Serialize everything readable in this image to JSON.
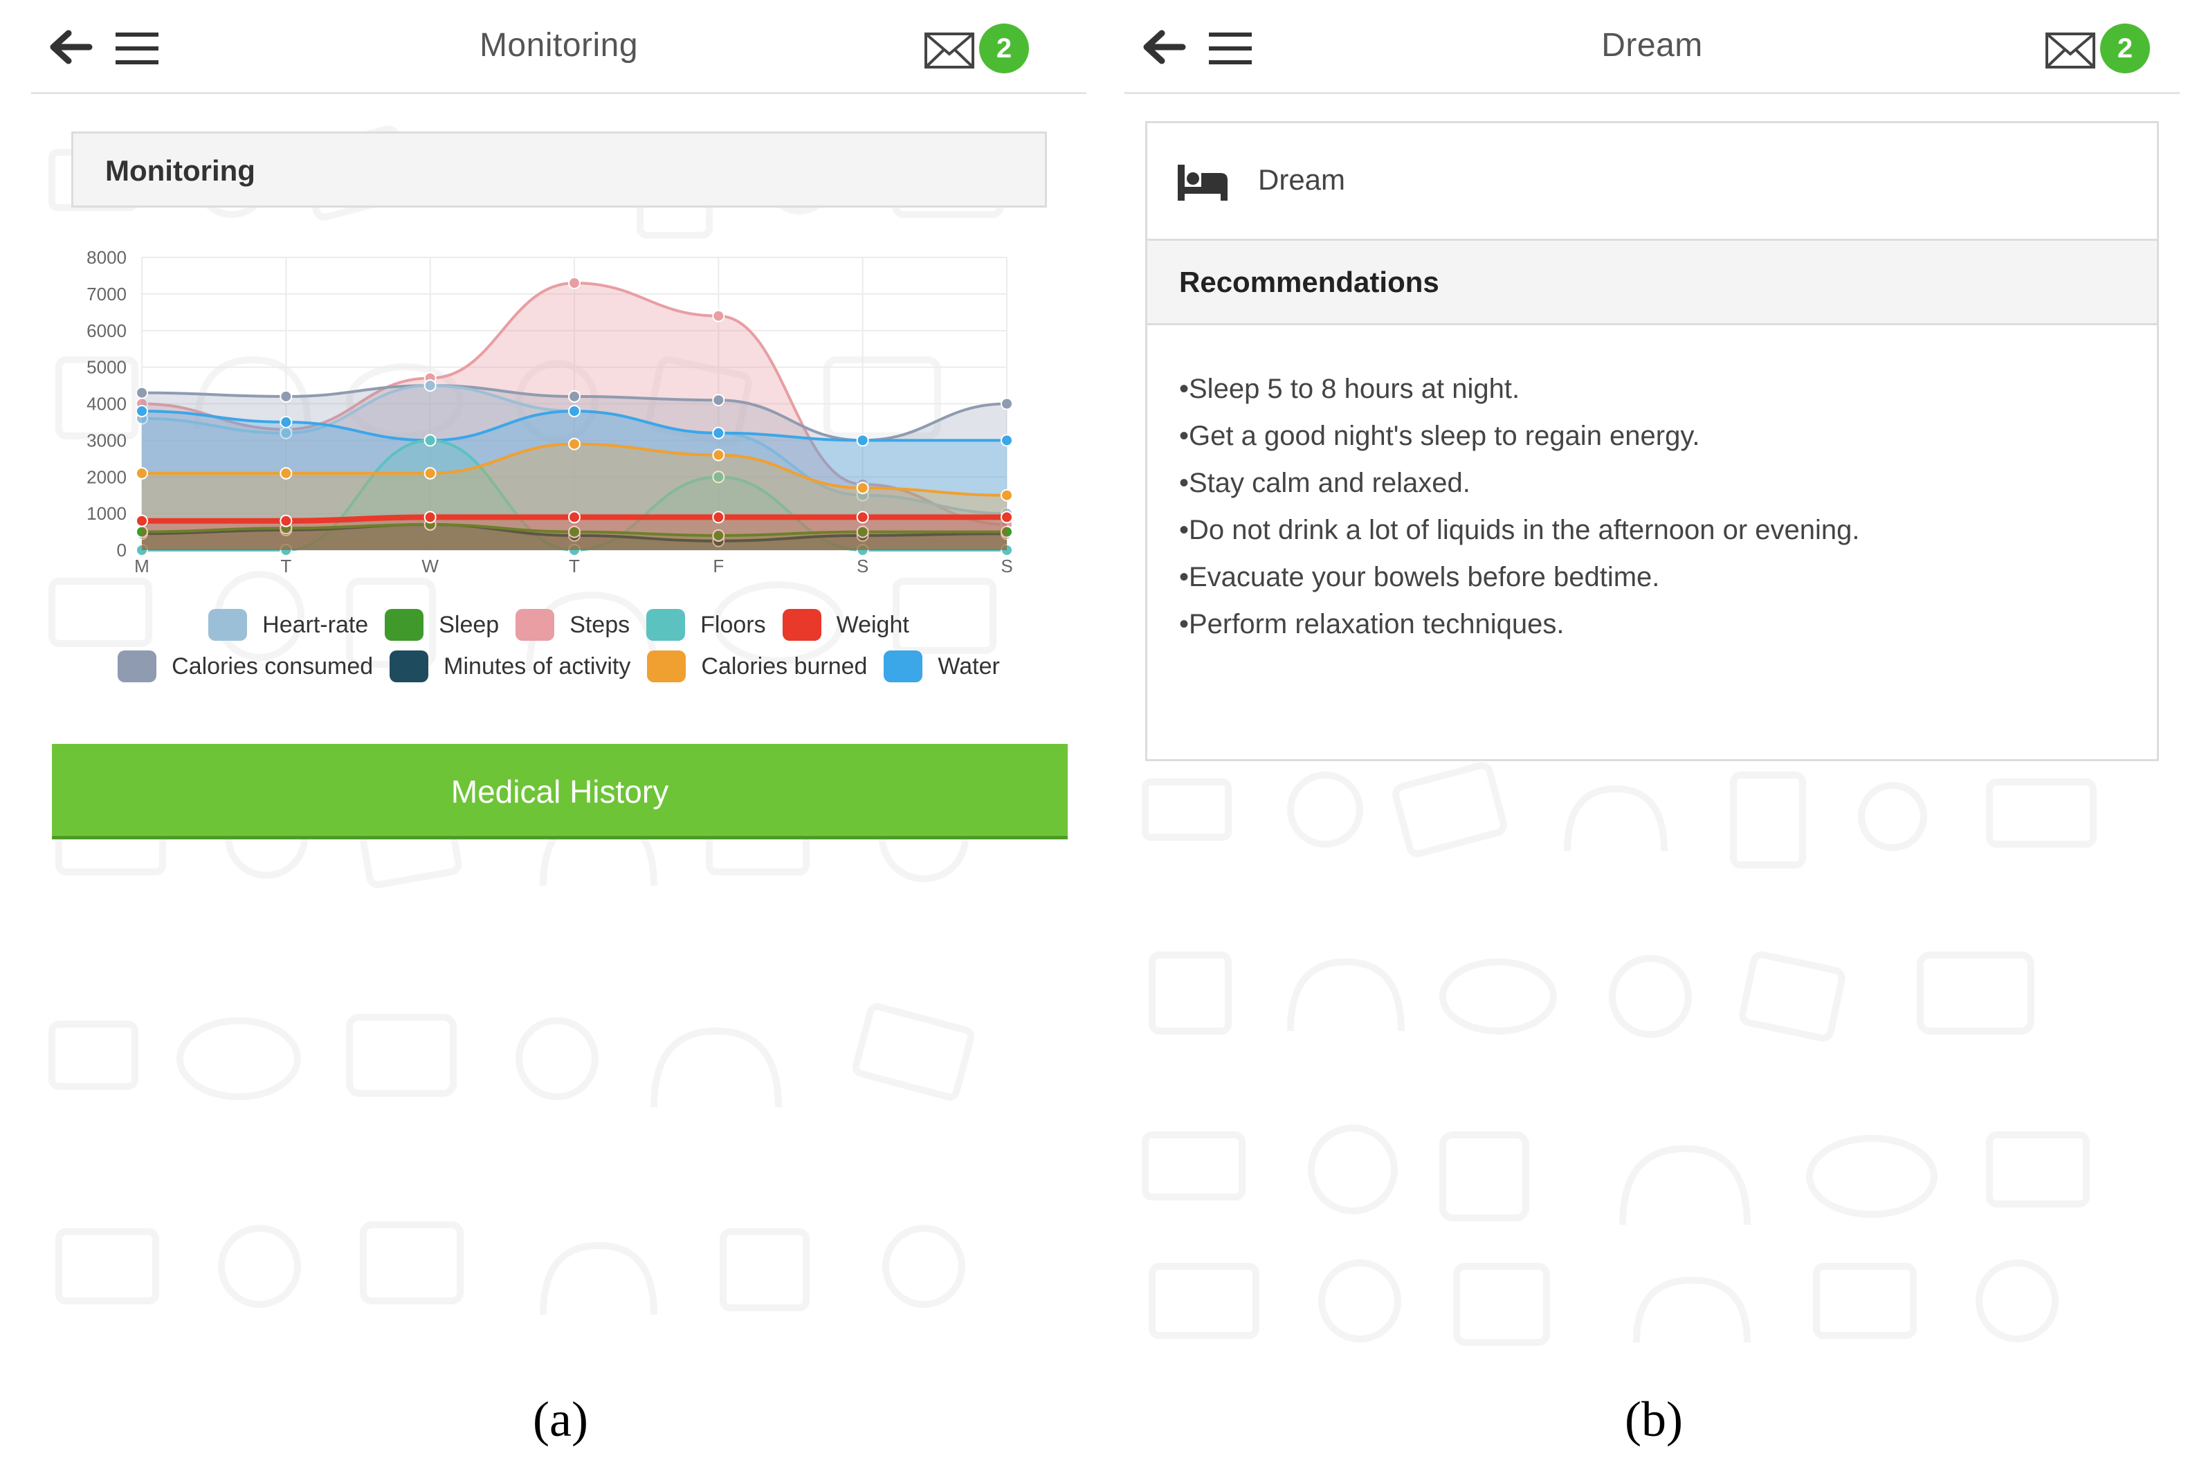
{
  "screen_a": {
    "title": "Monitoring",
    "badge_count": "2",
    "panel_title": "Monitoring",
    "icons": [
      "back-arrow-icon",
      "hamburger-menu-icon",
      "envelope-icon"
    ],
    "button_label": "Medical History",
    "caption": "(a)",
    "accent_color": "#6dc437"
  },
  "screen_b": {
    "title": "Dream",
    "badge_count": "2",
    "card_title": "Dream",
    "section_title": "Recommendations",
    "icons": [
      "back-arrow-icon",
      "hamburger-menu-icon",
      "envelope-icon",
      "bed-icon"
    ],
    "recommendations": [
      "•Sleep 5 to 8 hours at night.",
      "•Get a good night's sleep to regain energy.",
      "•Stay calm and relaxed.",
      "•Do not drink a lot of liquids in the afternoon or evening.",
      "•Evacuate your bowels before bedtime.",
      "•Perform relaxation techniques."
    ],
    "caption": "(b)"
  },
  "chart_data": {
    "type": "area",
    "categories": [
      "M",
      "T",
      "W",
      "T",
      "F",
      "S",
      "S"
    ],
    "ylim": [
      0,
      8000
    ],
    "yticks": [
      0,
      1000,
      2000,
      3000,
      4000,
      5000,
      6000,
      7000,
      8000
    ],
    "grid": true,
    "legend_position": "bottom",
    "series": [
      {
        "name": "Heart-rate",
        "color": "#9bbfd6",
        "values": [
          3600,
          3200,
          4500,
          3800,
          3200,
          1500,
          1000
        ]
      },
      {
        "name": "Sleep",
        "color": "#3f9a2b",
        "values": [
          500,
          600,
          700,
          500,
          400,
          500,
          500
        ]
      },
      {
        "name": "Steps",
        "color": "#e89ea3",
        "values": [
          4000,
          3300,
          4700,
          7300,
          6400,
          1800,
          700
        ]
      },
      {
        "name": "Floors",
        "color": "#5bc2c0",
        "values": [
          0,
          0,
          3000,
          0,
          2000,
          0,
          0
        ]
      },
      {
        "name": "Weight",
        "color": "#e8392b",
        "values": [
          800,
          800,
          900,
          900,
          900,
          900,
          900
        ]
      },
      {
        "name": "Calories consumed",
        "color": "#8f9bb0",
        "values": [
          4300,
          4200,
          4500,
          4200,
          4100,
          3000,
          4000
        ]
      },
      {
        "name": "Minutes of activity",
        "color": "#1f4b5e",
        "values": [
          450,
          550,
          700,
          400,
          250,
          400,
          450
        ]
      },
      {
        "name": "Calories burned",
        "color": "#f0a030",
        "values": [
          2100,
          2100,
          2100,
          2900,
          2600,
          1700,
          1500
        ]
      },
      {
        "name": "Water",
        "color": "#3ba6e8",
        "values": [
          3800,
          3500,
          3000,
          3800,
          3200,
          3000,
          3000
        ]
      }
    ]
  }
}
